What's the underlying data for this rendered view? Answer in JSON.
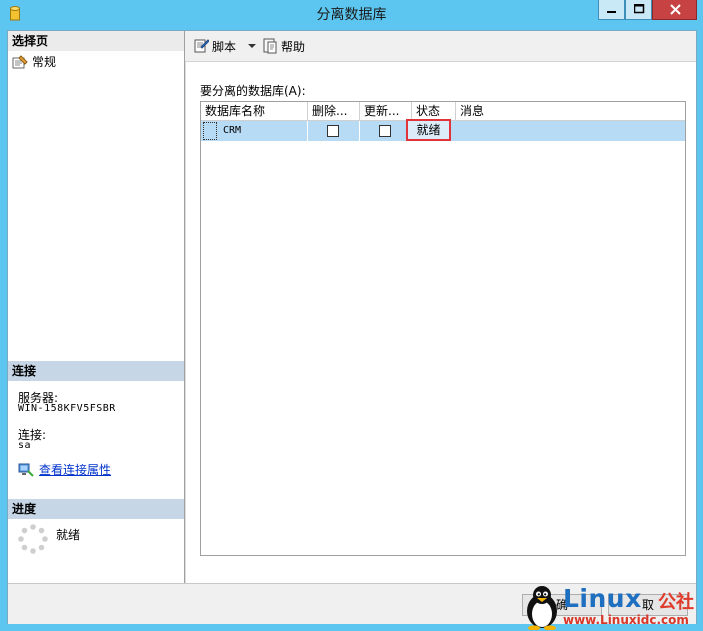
{
  "window": {
    "title": "分离数据库",
    "controls": {
      "minimize": "minimize-icon",
      "maximize": "maximize-icon",
      "close": "close-icon"
    }
  },
  "left": {
    "select_page_title": "选择页",
    "pages": [
      {
        "label": "常规",
        "icon": "page-general-icon"
      }
    ],
    "connection": {
      "title": "连接",
      "server_label": "服务器:",
      "server_value": "WIN-158KFV5FSBR",
      "login_label": "连接:",
      "login_value": "sa",
      "view_props_link": "查看连接属性"
    },
    "progress": {
      "title": "进度",
      "status": "就绪"
    }
  },
  "toolbar": {
    "script_label": "脚本",
    "help_label": "帮助"
  },
  "grid": {
    "label": "要分离的数据库(A):",
    "columns": [
      "数据库名称",
      "删除...",
      "更新...",
      "状态",
      "消息"
    ],
    "rows": [
      {
        "name": "CRM",
        "drop_connections": false,
        "update_statistics": false,
        "status": "就绪",
        "message": ""
      }
    ]
  },
  "buttons": {
    "ok_partial": "确",
    "cancel_partial": "取"
  },
  "watermark": {
    "brand": "Linux",
    "cn": "公社",
    "url": "www.Linuxidc.com"
  },
  "colors": {
    "titlebar": "#5cc6f0",
    "section": "#c6d6e6",
    "selection": "#b8dbf5",
    "highlight": "#e0343a",
    "link": "#0033cc"
  }
}
